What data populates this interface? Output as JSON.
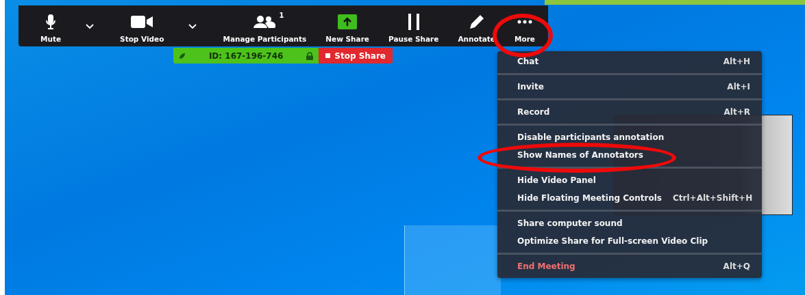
{
  "toolbar": {
    "buttons": [
      {
        "kind": "mic",
        "label": "Mute",
        "has_menu": true
      },
      {
        "kind": "video",
        "label": "Stop Video",
        "has_menu": true
      },
      {
        "kind": "participants",
        "label": "Manage Participants",
        "badge": "1",
        "has_menu": false
      },
      {
        "kind": "share",
        "label": "New Share",
        "has_menu": false
      },
      {
        "kind": "pause",
        "label": "Pause Share",
        "has_menu": false
      },
      {
        "kind": "annotate",
        "label": "Annotate",
        "has_menu": false
      },
      {
        "kind": "more",
        "label": "More",
        "has_menu": false
      }
    ]
  },
  "share_bar": {
    "meeting_id": "ID: 167-196-746",
    "stop_label": "Stop Share"
  },
  "menu": {
    "groups": [
      [
        {
          "label": "Chat",
          "shortcut": "Alt+H",
          "kind": "normal"
        }
      ],
      [
        {
          "label": "Invite",
          "shortcut": "Alt+I",
          "kind": "normal"
        }
      ],
      [
        {
          "label": "Record",
          "shortcut": "Alt+R",
          "kind": "normal"
        }
      ],
      [
        {
          "label": "Disable participants annotation",
          "kind": "normal"
        },
        {
          "label": "Show Names of Annotators",
          "kind": "normal"
        }
      ],
      [
        {
          "label": "Hide Video Panel",
          "kind": "normal"
        },
        {
          "label": "Hide Floating Meeting Controls",
          "shortcut": "Ctrl+Alt+Shift+H",
          "kind": "normal"
        }
      ],
      [
        {
          "label": "Share computer sound",
          "kind": "normal"
        },
        {
          "label": "Optimize Share for Full-screen Video Clip",
          "kind": "normal"
        }
      ],
      [
        {
          "label": "End Meeting",
          "shortcut": "Alt+Q",
          "kind": "danger"
        }
      ]
    ]
  }
}
